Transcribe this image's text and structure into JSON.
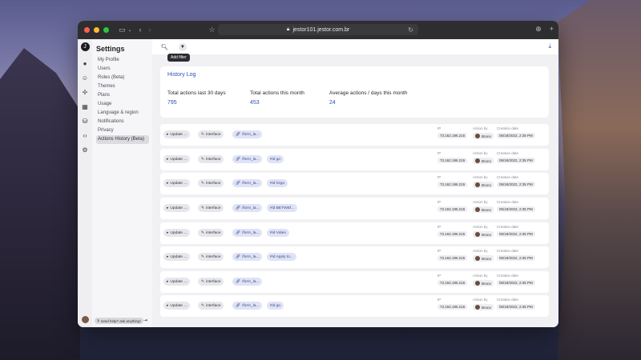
{
  "browser": {
    "url": "jestor101.jestor.com.br"
  },
  "settings": {
    "title": "Settings",
    "items": [
      "My Profile",
      "Users",
      "Roles (Beta)",
      "Themes",
      "Plans",
      "Usage",
      "Language & region",
      "Notifications",
      "Privacy",
      "Actions History (Beta)"
    ],
    "help": "need help? ask anything!"
  },
  "topbar": {
    "tooltip": "Add filter"
  },
  "history": {
    "title": "History Log",
    "stats": [
      {
        "label": "Total actions last 30 days",
        "value": "795"
      },
      {
        "label": "Total actions this month",
        "value": "453"
      },
      {
        "label": "Average actions / days this month",
        "value": "24"
      }
    ]
  },
  "table": {
    "col_ip": "IP",
    "col_action_by": "Action by",
    "col_date": "Creation date",
    "rows": [
      {
        "action": "Update ...",
        "source": "interface",
        "form": "/form_la...",
        "tag": "",
        "ip": "73.162.196.215",
        "user": "Bruno",
        "date": "05/18/2022, 2:35 PM"
      },
      {
        "action": "Update ...",
        "source": "interface",
        "form": "/form_la...",
        "tag": "#id  go",
        "ip": "73.162.196.215",
        "user": "Bruno",
        "date": "05/18/2022, 2:35 PM"
      },
      {
        "action": "Update ...",
        "source": "interface",
        "form": "/form_la...",
        "tag": "#id  hzgo",
        "ip": "73.162.196.215",
        "user": "Bruno",
        "date": "05/18/2022, 2:35 PM"
      },
      {
        "action": "Update ...",
        "source": "interface",
        "form": "/form_la...",
        "tag": "#id  BETWEf...",
        "ip": "73.162.196.215",
        "user": "Bruno",
        "date": "05/18/2022, 2:35 PM"
      },
      {
        "action": "Update ...",
        "source": "interface",
        "form": "/form_la...",
        "tag": "#id  Video",
        "ip": "73.162.196.215",
        "user": "Bruno",
        "date": "05/18/2022, 2:35 PM"
      },
      {
        "action": "Update ...",
        "source": "interface",
        "form": "/form_la...",
        "tag": "#id  Apply to...",
        "ip": "73.162.196.215",
        "user": "Bruno",
        "date": "05/18/2022, 2:35 PM"
      },
      {
        "action": "Update ...",
        "source": "interface",
        "form": "/form_la...",
        "tag": "",
        "ip": "73.162.196.215",
        "user": "Bruno",
        "date": "05/18/2022, 2:35 PM"
      },
      {
        "action": "Update ...",
        "source": "interface",
        "form": "/form_la...",
        "tag": "#id  go",
        "ip": "73.162.196.215",
        "user": "Bruno",
        "date": "05/18/2022, 2:35 PM"
      }
    ]
  }
}
